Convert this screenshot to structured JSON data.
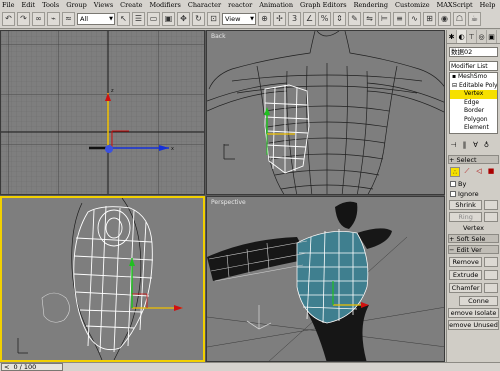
{
  "menu": {
    "items": [
      "File",
      "Edit",
      "Tools",
      "Group",
      "Views",
      "Create",
      "Modifiers",
      "Character",
      "reactor",
      "Animation",
      "Graph Editors",
      "Rendering",
      "Customize",
      "MAXScript",
      "Help"
    ]
  },
  "toolbar": {
    "selection_filter": "All",
    "reference_coord": "View"
  },
  "viewports": {
    "top_left_label": "",
    "top_right_label": "Back",
    "bottom_left_label": "",
    "bottom_right_label": "Perspective",
    "active": "bottom_left"
  },
  "command_panel": {
    "object_name": "数据02",
    "modifier_list": "Modifier List",
    "stack": {
      "mesh_smooth": "MeshSmo",
      "editable_poly": "Editable Poly",
      "vertex": "Vertex",
      "edge": "Edge",
      "border": "Border",
      "polygon": "Polygon",
      "element": "Element"
    },
    "selection_rollout": "Select",
    "by": "By",
    "ignore": "Ignore",
    "shrink": "Shrink",
    "ring": "Ring",
    "vertex_label": "Vertex",
    "soft_selection_rollout": "Soft Sele",
    "edit_vertices_rollout": "Edit Ver",
    "remove": "Remove",
    "extrude": "Extrude",
    "chamfer": "Chamfer",
    "connect": "Conne",
    "remove_isolated": "emove Isolate",
    "remove_unused": "emove Unused"
  },
  "status": {
    "timeline": "0 / 100"
  },
  "colors": {
    "selected_vertex": "#f6e000",
    "active_viewport_border": "#f2d000",
    "mesh_selected_fill": "#3f7f8f"
  }
}
